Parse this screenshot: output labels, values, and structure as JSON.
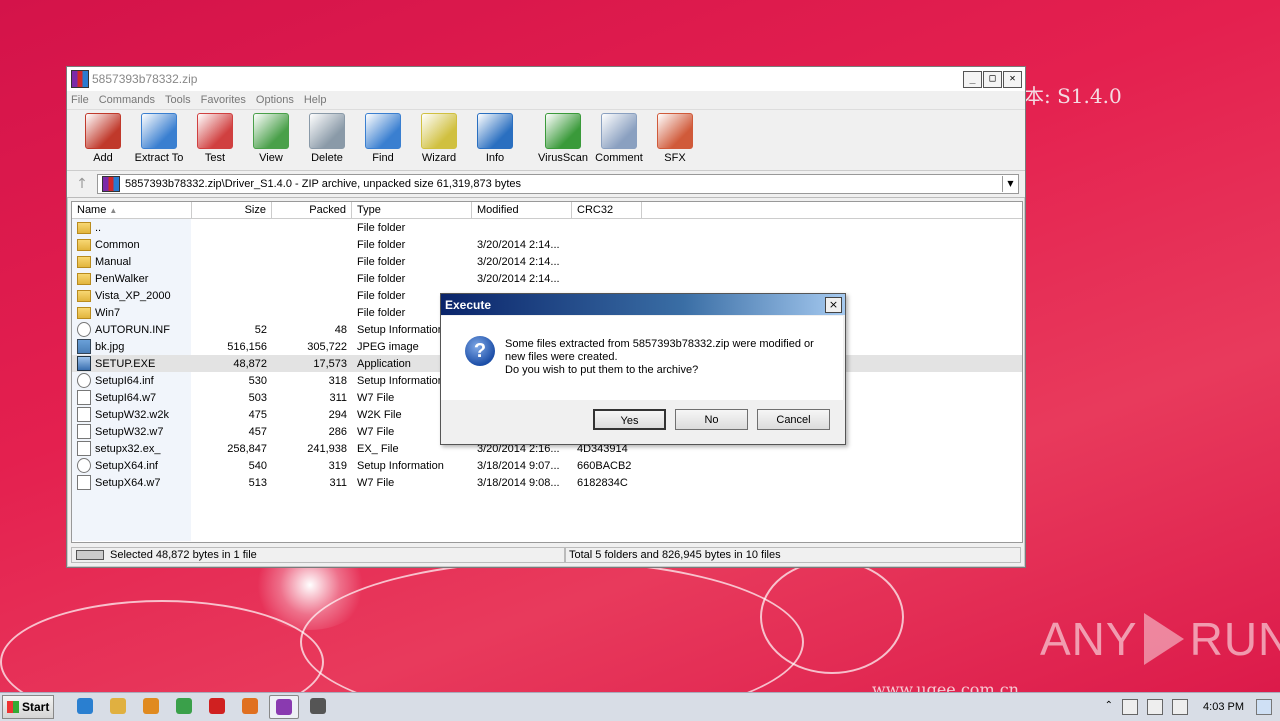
{
  "wallpaper": {
    "version_text": "本: S1.4.0",
    "url_text": "www.ugee.com.cn",
    "watermark": "ANY RUN"
  },
  "winrar": {
    "title": "5857393b78332.zip",
    "menu": [
      "File",
      "Commands",
      "Tools",
      "Favorites",
      "Options",
      "Help"
    ],
    "toolbar": [
      {
        "label": "Add",
        "icon": "add-archive-icon",
        "color": "#c0392b"
      },
      {
        "label": "Extract To",
        "icon": "extract-folder-icon",
        "color": "#3a7fd0"
      },
      {
        "label": "Test",
        "icon": "test-clipboard-icon",
        "color": "#d04040"
      },
      {
        "label": "View",
        "icon": "view-book-icon",
        "color": "#4aa04a"
      },
      {
        "label": "Delete",
        "icon": "trash-icon",
        "color": "#8a9aa8"
      },
      {
        "label": "Find",
        "icon": "magnifier-icon",
        "color": "#3a7fd0"
      },
      {
        "label": "Wizard",
        "icon": "wand-icon",
        "color": "#d0c040"
      },
      {
        "label": "Info",
        "icon": "info-icon",
        "color": "#2a6fc0"
      },
      {
        "label": "VirusScan",
        "icon": "virus-scan-icon",
        "color": "#3a9a3a"
      },
      {
        "label": "Comment",
        "icon": "comment-icon",
        "color": "#8aa0c0"
      },
      {
        "label": "SFX",
        "icon": "sfx-boxes-icon",
        "color": "#d05a3a"
      }
    ],
    "path": "5857393b78332.zip\\Driver_S1.4.0 - ZIP archive, unpacked size 61,319,873 bytes",
    "columns": [
      "Name",
      "Size",
      "Packed",
      "Type",
      "Modified",
      "CRC32"
    ],
    "rows": [
      {
        "name": "..",
        "size": "",
        "packed": "",
        "type": "File folder",
        "modified": "",
        "crc": "",
        "icon": "folder"
      },
      {
        "name": "Common",
        "size": "",
        "packed": "",
        "type": "File folder",
        "modified": "3/20/2014 2:14...",
        "crc": "",
        "icon": "folder"
      },
      {
        "name": "Manual",
        "size": "",
        "packed": "",
        "type": "File folder",
        "modified": "3/20/2014 2:14...",
        "crc": "",
        "icon": "folder"
      },
      {
        "name": "PenWalker",
        "size": "",
        "packed": "",
        "type": "File folder",
        "modified": "3/20/2014 2:14...",
        "crc": "",
        "icon": "folder"
      },
      {
        "name": "Vista_XP_2000",
        "size": "",
        "packed": "",
        "type": "File folder",
        "modified": "",
        "crc": "",
        "icon": "folder"
      },
      {
        "name": "Win7",
        "size": "",
        "packed": "",
        "type": "File folder",
        "modified": "",
        "crc": "",
        "icon": "folder"
      },
      {
        "name": "AUTORUN.INF",
        "size": "52",
        "packed": "48",
        "type": "Setup Information",
        "modified": "",
        "crc": "",
        "icon": "gear"
      },
      {
        "name": "bk.jpg",
        "size": "516,156",
        "packed": "305,722",
        "type": "JPEG image",
        "modified": "",
        "crc": "",
        "icon": "img"
      },
      {
        "name": "SETUP.EXE",
        "size": "48,872",
        "packed": "17,573",
        "type": "Application",
        "modified": "",
        "crc": "",
        "icon": "app",
        "selected": true
      },
      {
        "name": "SetupI64.inf",
        "size": "530",
        "packed": "318",
        "type": "Setup Information",
        "modified": "",
        "crc": "",
        "icon": "gear"
      },
      {
        "name": "SetupI64.w7",
        "size": "503",
        "packed": "311",
        "type": "W7 File",
        "modified": "",
        "crc": "",
        "icon": "file"
      },
      {
        "name": "SetupW32.w2k",
        "size": "475",
        "packed": "294",
        "type": "W2K File",
        "modified": "",
        "crc": "",
        "icon": "file"
      },
      {
        "name": "SetupW32.w7",
        "size": "457",
        "packed": "286",
        "type": "W7 File",
        "modified": "",
        "crc": "",
        "icon": "file"
      },
      {
        "name": "setupx32.ex_",
        "size": "258,847",
        "packed": "241,938",
        "type": "EX_ File",
        "modified": "3/20/2014 2:16...",
        "crc": "4D343914",
        "icon": "file"
      },
      {
        "name": "SetupX64.inf",
        "size": "540",
        "packed": "319",
        "type": "Setup Information",
        "modified": "3/18/2014 9:07...",
        "crc": "660BACB2",
        "icon": "gear"
      },
      {
        "name": "SetupX64.w7",
        "size": "513",
        "packed": "311",
        "type": "W7 File",
        "modified": "3/18/2014 9:08...",
        "crc": "6182834C",
        "icon": "file"
      }
    ],
    "status_left": "Selected 48,872 bytes in 1 file",
    "status_right": "Total 5 folders and 826,945 bytes in 10 files"
  },
  "dialog": {
    "title": "Execute",
    "close": "×",
    "line1": "Some files extracted from 5857393b78332.zip were modified or",
    "line2": "new files were created.",
    "line3": "Do you wish to put them to the archive?",
    "yes": "Yes",
    "no": "No",
    "cancel": "Cancel"
  },
  "taskbar": {
    "start": "Start",
    "items": [
      {
        "icon": "ie-icon",
        "color": "#2a7fd0"
      },
      {
        "icon": "explorer-icon",
        "color": "#e0b040"
      },
      {
        "icon": "media-player-icon",
        "color": "#e08a20"
      },
      {
        "icon": "chrome-icon",
        "color": "#3aa04a"
      },
      {
        "icon": "opera-icon",
        "color": "#d02020"
      },
      {
        "icon": "firefox-icon",
        "color": "#e07020"
      },
      {
        "icon": "winrar-icon",
        "color": "#8a3ab0",
        "active": true
      },
      {
        "icon": "setup-icon",
        "color": "#555555"
      }
    ],
    "clock": "4:03 PM"
  }
}
